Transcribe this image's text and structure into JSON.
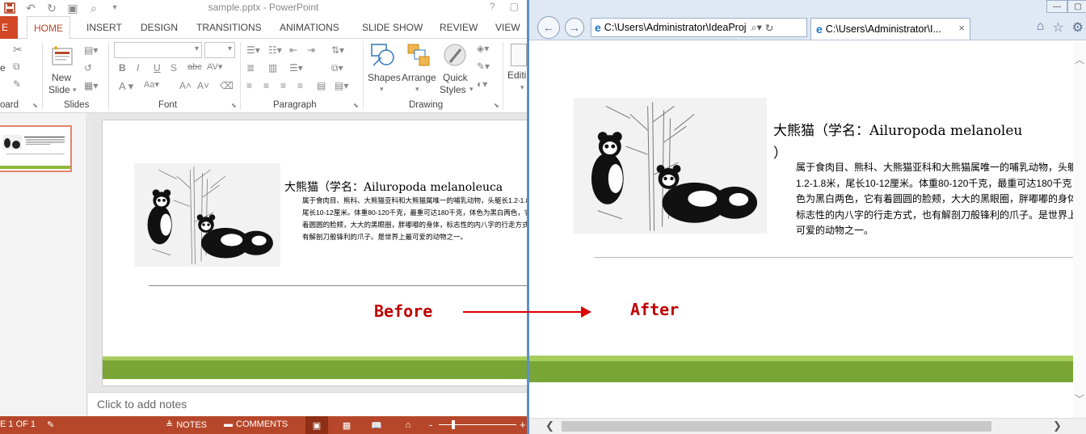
{
  "powerpoint": {
    "title": "sample.pptx - PowerPoint",
    "window_controls": [
      "?",
      "▢"
    ],
    "file_tab": "E",
    "tabs": [
      "HOME",
      "INSERT",
      "DESIGN",
      "TRANSITIONS",
      "ANIMATIONS",
      "SLIDE SHOW",
      "REVIEW",
      "VIEW"
    ],
    "active_tab": "HOME",
    "ribbon": {
      "groups": [
        "oard",
        "Slides",
        "Font",
        "Paragraph",
        "Drawing"
      ],
      "new_slide_label": "New",
      "new_slide_label2": "Slide",
      "paste_fragment": "e",
      "shapes_label": "Shapes",
      "arrange_label": "Arrange",
      "quick_styles_label": "Quick",
      "quick_styles_label2": "Styles",
      "editing_label": "Editi"
    },
    "slide": {
      "title": "大熊猫（学名：Ailuropoda melanoleuca",
      "body": "属于食肉目、熊科、大熊猫亚科和大熊猫属唯一的哺乳动物，头躯长1.2-1.8米，尾长10-12厘米。体重80-120千克，最重可达180千克，体色为黑白两色，它有着圆圆的脸颊，大大的黑眼圈，胖嘟嘟的身体，标志性的内八字的行走方式，也有解剖刀般锋利的爪子。是世界上最可爱的动物之一。"
    },
    "notes_placeholder": "Click to add notes",
    "status": {
      "slide_counter": "E 1 OF 1",
      "notes_label": "NOTES",
      "comments_label": "COMMENTS",
      "zoom_minus": "-",
      "zoom_plus": "+"
    }
  },
  "browser": {
    "address": "C:\\Users\\Administrator\\IdeaProj",
    "tab_title": "C:\\Users\\Administrator\\I...",
    "tab_close": "×",
    "page_title_line1": "大熊猫（学名：Ailuropoda melanoleu",
    "page_title_line2": "）",
    "page_body": "属于食肉目、熊科、大熊猫亚科和大熊猫属唯一的哺乳动物，头躯长1.2-1.8米，尾长10-12厘米。体重80-120千克，最重可达180千克，体色为黑白两色，它有着圆圆的脸颊，大大的黑眼圈，胖嘟嘟的身体，标志性的内八字的行走方式，也有解剖刀般锋利的爪子。是世界上最可爱的动物之一。"
  },
  "annotations": {
    "before": "Before",
    "after": "After"
  },
  "colors": {
    "ppt_accent": "#b7472a",
    "band_dark": "#78a535",
    "band_light": "#a6cc5b",
    "annotation_red": "#c00000"
  }
}
